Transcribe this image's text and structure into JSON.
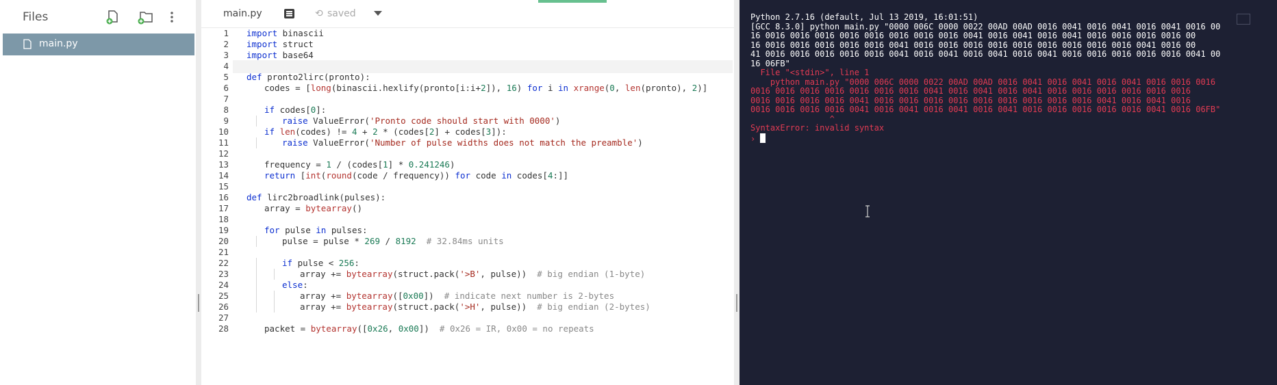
{
  "sidebar": {
    "title": "Files",
    "files": [
      {
        "name": "main.py",
        "selected": true
      }
    ]
  },
  "editor": {
    "tab": "main.py",
    "save_status": "saved",
    "lines": [
      {
        "n": "1",
        "indent": 0,
        "spans": [
          [
            "kw",
            "import"
          ],
          [
            "t",
            " binascii"
          ]
        ]
      },
      {
        "n": "2",
        "indent": 0,
        "spans": [
          [
            "kw",
            "import"
          ],
          [
            "t",
            " struct"
          ]
        ]
      },
      {
        "n": "3",
        "indent": 0,
        "spans": [
          [
            "kw",
            "import"
          ],
          [
            "t",
            " base64"
          ]
        ]
      },
      {
        "n": "4",
        "indent": 0,
        "spans": []
      },
      {
        "n": "5",
        "indent": 0,
        "spans": [
          [
            "kw",
            "def"
          ],
          [
            "t",
            " pronto2lirc(pronto):"
          ]
        ]
      },
      {
        "n": "6",
        "indent": 1,
        "spans": [
          [
            "t",
            "codes = ["
          ],
          [
            "fn",
            "long"
          ],
          [
            "t",
            "(binascii.hexlify(pronto[i:i+"
          ],
          [
            "nm",
            "2"
          ],
          [
            "t",
            "]), "
          ],
          [
            "nm",
            "16"
          ],
          [
            "t",
            ") "
          ],
          [
            "kw",
            "for"
          ],
          [
            "t",
            " i "
          ],
          [
            "kw",
            "in"
          ],
          [
            "t",
            " "
          ],
          [
            "fn",
            "xrange"
          ],
          [
            "t",
            "("
          ],
          [
            "nm",
            "0"
          ],
          [
            "t",
            ", "
          ],
          [
            "fn",
            "len"
          ],
          [
            "t",
            "(pronto), "
          ],
          [
            "nm",
            "2"
          ],
          [
            "t",
            ")]"
          ]
        ]
      },
      {
        "n": "7",
        "indent": 0,
        "spans": []
      },
      {
        "n": "8",
        "indent": 1,
        "spans": [
          [
            "kw",
            "if"
          ],
          [
            "t",
            " codes["
          ],
          [
            "nm",
            "0"
          ],
          [
            "t",
            "]:"
          ]
        ]
      },
      {
        "n": "9",
        "indent": 2,
        "spans": [
          [
            "kw",
            "raise"
          ],
          [
            "t",
            " ValueError("
          ],
          [
            "st",
            "'Pronto code should start with 0000'"
          ],
          [
            "t",
            ")"
          ]
        ]
      },
      {
        "n": "10",
        "indent": 1,
        "spans": [
          [
            "kw",
            "if"
          ],
          [
            "t",
            " "
          ],
          [
            "fn",
            "len"
          ],
          [
            "t",
            "(codes) != "
          ],
          [
            "nm",
            "4"
          ],
          [
            "t",
            " + "
          ],
          [
            "nm",
            "2"
          ],
          [
            "t",
            " * (codes["
          ],
          [
            "nm",
            "2"
          ],
          [
            "t",
            "] + codes["
          ],
          [
            "nm",
            "3"
          ],
          [
            "t",
            "]):"
          ]
        ]
      },
      {
        "n": "11",
        "indent": 2,
        "spans": [
          [
            "kw",
            "raise"
          ],
          [
            "t",
            " ValueError("
          ],
          [
            "st",
            "'Number of pulse widths does not match the preamble'"
          ],
          [
            "t",
            ")"
          ]
        ]
      },
      {
        "n": "12",
        "indent": 0,
        "spans": []
      },
      {
        "n": "13",
        "indent": 1,
        "spans": [
          [
            "t",
            "frequency = "
          ],
          [
            "nm",
            "1"
          ],
          [
            "t",
            " / (codes["
          ],
          [
            "nm",
            "1"
          ],
          [
            "t",
            "] * "
          ],
          [
            "nm",
            "0.241246"
          ],
          [
            "t",
            ")"
          ]
        ]
      },
      {
        "n": "14",
        "indent": 1,
        "spans": [
          [
            "kw",
            "return"
          ],
          [
            "t",
            " ["
          ],
          [
            "fn",
            "int"
          ],
          [
            "t",
            "("
          ],
          [
            "fn",
            "round"
          ],
          [
            "t",
            "(code / frequency)) "
          ],
          [
            "kw",
            "for"
          ],
          [
            "t",
            " code "
          ],
          [
            "kw",
            "in"
          ],
          [
            "t",
            " codes["
          ],
          [
            "nm",
            "4"
          ],
          [
            "t",
            ":]]"
          ]
        ]
      },
      {
        "n": "15",
        "indent": 0,
        "spans": []
      },
      {
        "n": "16",
        "indent": 0,
        "spans": [
          [
            "kw",
            "def"
          ],
          [
            "t",
            " lirc2broadlink(pulses):"
          ]
        ]
      },
      {
        "n": "17",
        "indent": 1,
        "spans": [
          [
            "t",
            "array = "
          ],
          [
            "fn",
            "bytearray"
          ],
          [
            "t",
            "()"
          ]
        ]
      },
      {
        "n": "18",
        "indent": 0,
        "spans": []
      },
      {
        "n": "19",
        "indent": 1,
        "spans": [
          [
            "kw",
            "for"
          ],
          [
            "t",
            " pulse "
          ],
          [
            "kw",
            "in"
          ],
          [
            "t",
            " pulses:"
          ]
        ]
      },
      {
        "n": "20",
        "indent": 2,
        "spans": [
          [
            "t",
            "pulse = pulse * "
          ],
          [
            "nm",
            "269"
          ],
          [
            "t",
            " / "
          ],
          [
            "nm",
            "8192"
          ],
          [
            "t",
            "  "
          ],
          [
            "cm",
            "# 32.84ms units"
          ]
        ]
      },
      {
        "n": "21",
        "indent": 0,
        "spans": []
      },
      {
        "n": "22",
        "indent": 2,
        "spans": [
          [
            "kw",
            "if"
          ],
          [
            "t",
            " pulse < "
          ],
          [
            "nm",
            "256"
          ],
          [
            "t",
            ":"
          ]
        ]
      },
      {
        "n": "23",
        "indent": 3,
        "spans": [
          [
            "t",
            "array += "
          ],
          [
            "fn",
            "bytearray"
          ],
          [
            "t",
            "(struct.pack("
          ],
          [
            "st",
            "'>B'"
          ],
          [
            "t",
            ", pulse))  "
          ],
          [
            "cm",
            "# big endian (1-byte)"
          ]
        ]
      },
      {
        "n": "24",
        "indent": 2,
        "spans": [
          [
            "kw",
            "else"
          ],
          [
            "t",
            ":"
          ]
        ]
      },
      {
        "n": "25",
        "indent": 3,
        "spans": [
          [
            "t",
            "array += "
          ],
          [
            "fn",
            "bytearray"
          ],
          [
            "t",
            "(["
          ],
          [
            "nm",
            "0x00"
          ],
          [
            "t",
            "])  "
          ],
          [
            "cm",
            "# indicate next number is 2-bytes"
          ]
        ]
      },
      {
        "n": "26",
        "indent": 3,
        "spans": [
          [
            "t",
            "array += "
          ],
          [
            "fn",
            "bytearray"
          ],
          [
            "t",
            "(struct.pack("
          ],
          [
            "st",
            "'>H'"
          ],
          [
            "t",
            ", pulse))  "
          ],
          [
            "cm",
            "# big endian (2-bytes)"
          ]
        ]
      },
      {
        "n": "27",
        "indent": 0,
        "spans": []
      },
      {
        "n": "28",
        "indent": 1,
        "spans": [
          [
            "t",
            "packet = "
          ],
          [
            "fn",
            "bytearray"
          ],
          [
            "t",
            "(["
          ],
          [
            "nm",
            "0x26"
          ],
          [
            "t",
            ", "
          ],
          [
            "nm",
            "0x00"
          ],
          [
            "t",
            "])  "
          ],
          [
            "cm",
            "# 0x26 = IR, 0x00 = no repeats"
          ]
        ]
      }
    ]
  },
  "console": {
    "lines": [
      {
        "kind": "out",
        "text": "Python 2.7.16 (default, Jul 13 2019, 16:01:51)"
      },
      {
        "kind": "out",
        "text": "[GCC 8.3.0] python main.py \"0000 006C 0000 0022 00AD 00AD 0016 0041 0016 0041 0016 0041 0016 00"
      },
      {
        "kind": "out",
        "text": "16 0016 0016 0016 0016 0016 0016 0016 0016 0041 0016 0041 0016 0041 0016 0016 0016 0016 00"
      },
      {
        "kind": "out",
        "text": "16 0016 0016 0016 0016 0016 0041 0016 0016 0016 0016 0016 0016 0016 0016 0016 0041 0016 00"
      },
      {
        "kind": "out",
        "text": "41 0016 0016 0016 0016 0016 0041 0016 0041 0016 0041 0016 0041 0016 0016 0016 0016 0016 0041 00"
      },
      {
        "kind": "out",
        "text": "16 06FB\""
      },
      {
        "kind": "err",
        "text": "  File \"<stdin>\", line 1"
      },
      {
        "kind": "err",
        "text": "    python main.py \"0000 006C 0000 0022 00AD 00AD 0016 0041 0016 0041 0016 0041 0016 0016 0016"
      },
      {
        "kind": "err",
        "text": "0016 0016 0016 0016 0016 0016 0016 0041 0016 0041 0016 0041 0016 0016 0016 0016 0016 0016"
      },
      {
        "kind": "err",
        "text": "0016 0016 0016 0016 0041 0016 0016 0016 0016 0016 0016 0016 0016 0016 0041 0016 0041 0016"
      },
      {
        "kind": "err",
        "text": "0016 0016 0016 0016 0041 0016 0041 0016 0041 0016 0041 0016 0016 0016 0016 0016 0041 0016 06FB\""
      },
      {
        "kind": "err",
        "text": "                ^"
      },
      {
        "kind": "err",
        "text": "SyntaxError: invalid syntax"
      }
    ],
    "prompt": "›"
  },
  "colors": {
    "console_bg": "#1d2033",
    "error": "#e23b53",
    "keyword": "#0c2fd0",
    "string": "#a52a1f",
    "number": "#1a7a55",
    "selected_file": "#7d98a8"
  }
}
